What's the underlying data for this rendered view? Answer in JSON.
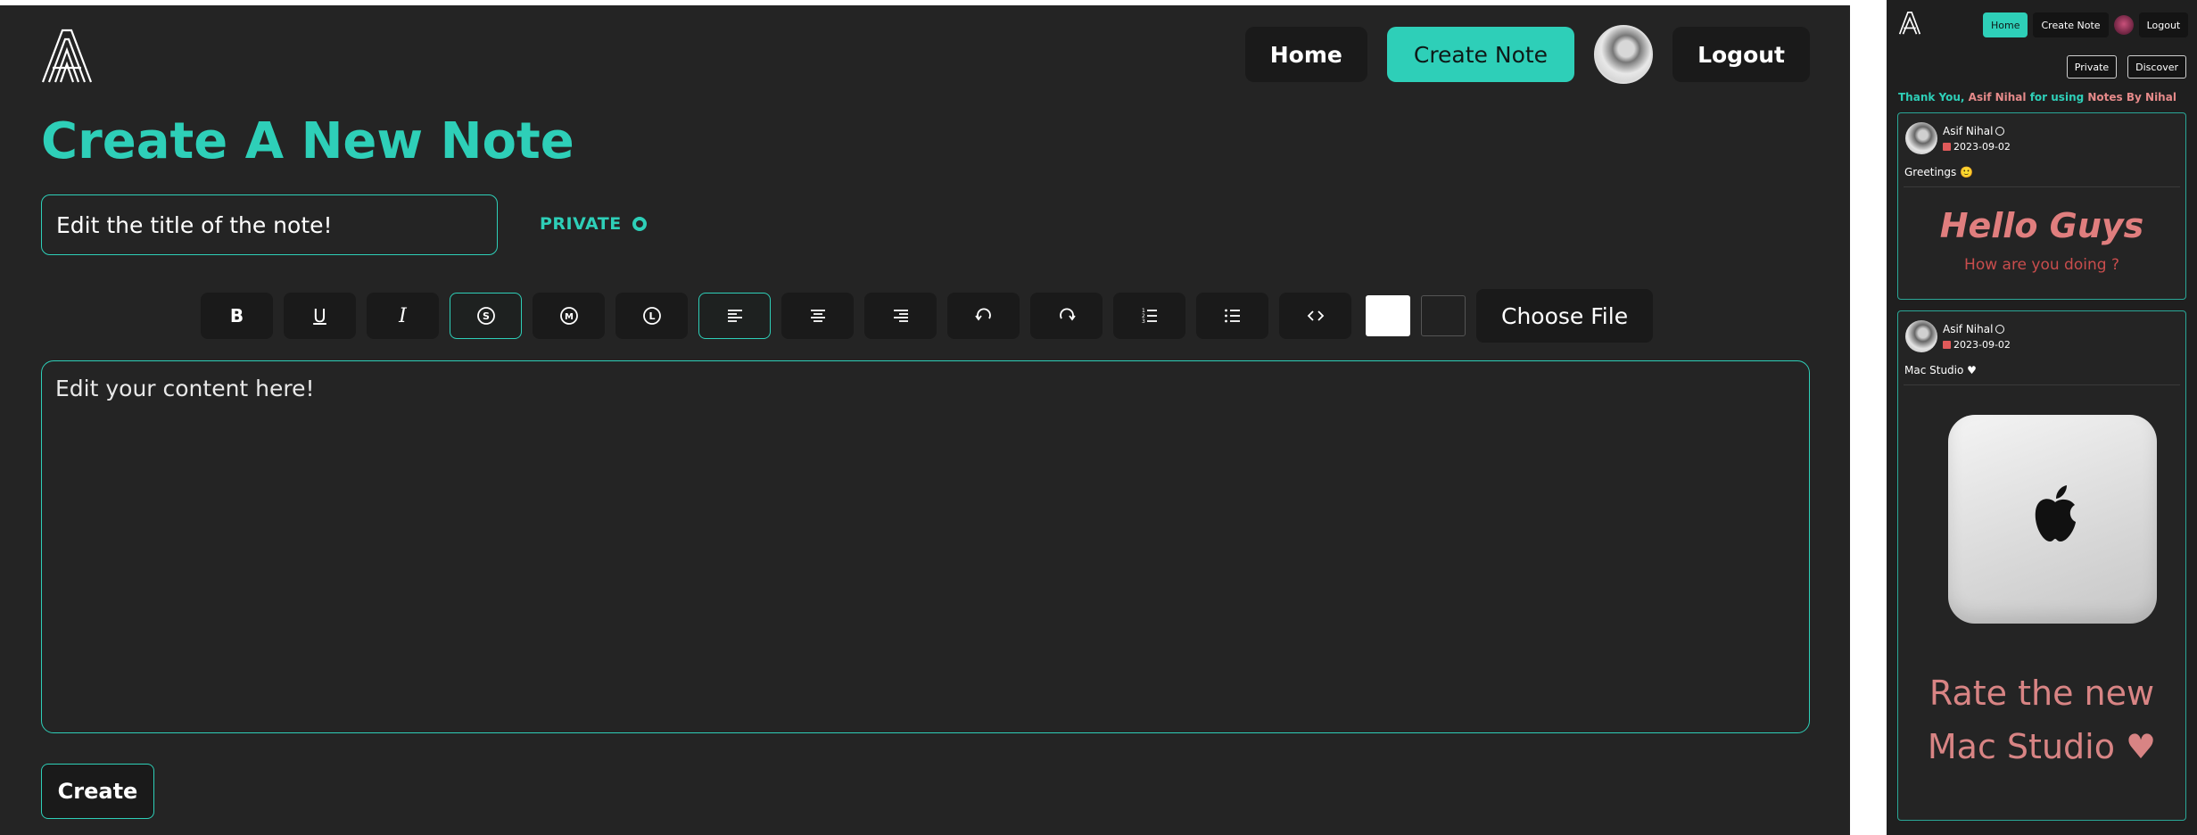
{
  "main": {
    "nav": {
      "home": "Home",
      "create_note": "Create Note",
      "logout": "Logout"
    },
    "page_title": "Create A New Note",
    "title_input": {
      "value": "Edit the title of the note!",
      "placeholder": "Edit the title of the note!"
    },
    "visibility": "PRIVATE",
    "toolbar": {
      "bold": "B",
      "underline": "U",
      "italic": "I",
      "small": "S",
      "medium": "M",
      "large": "L",
      "choose_file": "Choose File"
    },
    "editor_content": "Edit your content here!",
    "create_button": "Create"
  },
  "preview": {
    "nav": {
      "home": "Home",
      "create_note": "Create Note",
      "logout": "Logout"
    },
    "tabs": {
      "private": "Private",
      "discover": "Discover"
    },
    "thanks": {
      "prefix": "Thank You,",
      "user": "Asif Nihal",
      "middle": "for using",
      "app": "Notes By Nihal"
    },
    "notes": [
      {
        "author": "Asif Nihal",
        "date": "2023-09-02",
        "title": "Greetings 🙂",
        "heading": "Hello Guys",
        "subtext": "How are you doing ?"
      },
      {
        "author": "Asif Nihal",
        "date": "2023-09-02",
        "title": "Mac Studio ♥",
        "line1": "Rate the new",
        "line2": "Mac Studio ♥"
      }
    ]
  },
  "colors": {
    "accent": "#2ecfb8",
    "background": "#242424",
    "button": "#1a1a1a",
    "pink": "#e07e7e"
  },
  "icons": [
    "logo-icon",
    "globe-icon",
    "align-left-icon",
    "align-center-icon",
    "align-right-icon",
    "undo-icon",
    "redo-icon",
    "ordered-list-icon",
    "bullet-list-icon",
    "code-icon",
    "calendar-icon",
    "apple-logo-icon"
  ]
}
